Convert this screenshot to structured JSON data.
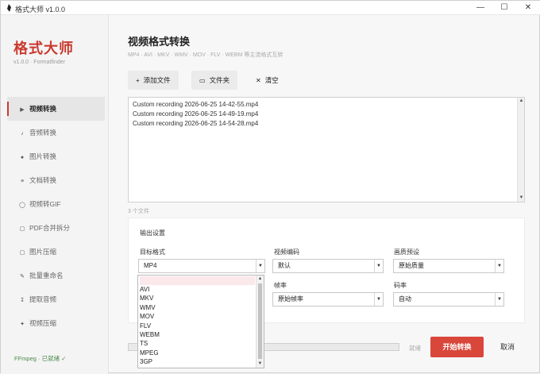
{
  "window": {
    "title": "格式大师 v1.0.0",
    "controls": [
      "—",
      "☐",
      "✕"
    ]
  },
  "sidebar": {
    "brand": "格式大师",
    "version": "v1.0.0 · Formatfinder",
    "items": [
      {
        "icon": "▶",
        "label": "视频转换",
        "active": true
      },
      {
        "icon": "♪",
        "label": "音频转换"
      },
      {
        "icon": "●",
        "label": "图片转换"
      },
      {
        "icon": "≡",
        "label": "文档转换"
      },
      {
        "icon": "◯",
        "label": "视频转GIF"
      },
      {
        "icon": "▢",
        "label": "PDF合并拆分"
      },
      {
        "icon": "▢",
        "label": "图片压缩"
      },
      {
        "icon": "✎",
        "label": "批量重命名"
      },
      {
        "icon": "↧",
        "label": "提取音频"
      },
      {
        "icon": "✦",
        "label": "视频压缩"
      }
    ],
    "ffmpeg_status": "FFmpeg · 已就绪 ✓"
  },
  "main": {
    "title": "视频格式转换",
    "subtitle": "MP4 · AVI · MKV · WMV · MOV · FLV · WEBM 等主流格式互转",
    "toolbar": {
      "add_file": {
        "icon": "+",
        "label": "添加文件"
      },
      "folder": {
        "icon": "▭",
        "label": "文件夹"
      },
      "clear": {
        "icon": "✕",
        "label": "清空"
      }
    },
    "files": [
      "Custom recording 2026-06-25 14-42-55.mp4",
      "Custom recording 2026-06-25 14-49-19.mp4",
      "Custom recording 2026-06-25 14-54-28.mp4"
    ],
    "file_count": "3 个文件",
    "settings": {
      "title": "输出设置",
      "target_format": {
        "label": "目标格式",
        "value": "MP4"
      },
      "video_codec": {
        "label": "视频编码",
        "value": "默认"
      },
      "quality_preset": {
        "label": "画质预设",
        "value": "原始质量"
      },
      "frame_rate": {
        "label": "帧率",
        "value": "原始帧率"
      },
      "bitrate": {
        "label": "码率",
        "value": "自动"
      }
    },
    "format_options": [
      "MP4",
      "AVI",
      "MKV",
      "WMV",
      "MOV",
      "FLV",
      "WEBM",
      "TS",
      "MPEG",
      "3GP"
    ],
    "progress": {
      "value": 0,
      "label": "就绪"
    },
    "start_button": "开始转换",
    "cancel_button": "取消"
  },
  "colors": {
    "accent": "#c93a2f",
    "button": "#d9473b"
  }
}
